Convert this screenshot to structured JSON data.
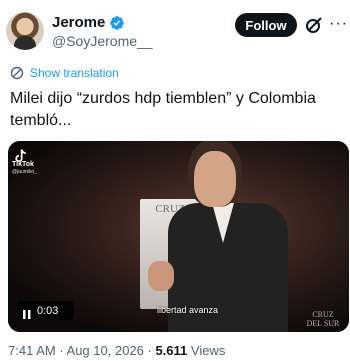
{
  "author": {
    "display_name": "Jerome",
    "handle": "@SoyJerome__",
    "verified_color": "#1d9bf0"
  },
  "actions": {
    "follow_label": "Follow",
    "grok_icon": "grok-icon",
    "more_icon": "more-horizontal-icon",
    "more_glyph": "···"
  },
  "translation": {
    "label": "Show translation"
  },
  "tweet": {
    "text": "Milei dijo “zurdos hdp tiemblen” y Colombia tembló..."
  },
  "media": {
    "tiktok_label": "TikTok",
    "tiktok_user": "@jaumilei_",
    "podium_text": "CRUZ",
    "caption": "libertad avanza",
    "watermark": "CRUZ DEL SUR",
    "time": "0:03"
  },
  "meta": {
    "timestamp": "7:41 AM · Aug 10, 2026 · ",
    "views_count": "5.611",
    "views_label": " Views"
  },
  "colors": {
    "accent": "#1d9bf0",
    "text_primary": "#0f1419",
    "text_secondary": "#536471"
  }
}
